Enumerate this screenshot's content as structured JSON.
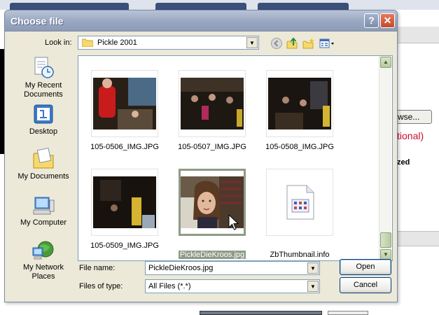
{
  "dialog": {
    "title": "Choose file",
    "help_glyph": "?",
    "close_glyph": "✕"
  },
  "lookin": {
    "label": "Look in:",
    "value": "Pickle 2001"
  },
  "toolbar": {
    "icons": [
      "back-icon",
      "up-folder-icon",
      "new-folder-icon",
      "views-menu-icon"
    ]
  },
  "places": [
    {
      "label": "My Recent Documents",
      "icon": "recent-documents-icon"
    },
    {
      "label": "Desktop",
      "icon": "desktop-icon"
    },
    {
      "label": "My Documents",
      "icon": "my-documents-icon"
    },
    {
      "label": "My Computer",
      "icon": "my-computer-icon"
    },
    {
      "label": "My Network Places",
      "icon": "network-places-icon"
    }
  ],
  "files": [
    {
      "name": "105-0506_IMG.JPG",
      "selected": false
    },
    {
      "name": "105-0507_IMG.JPG",
      "selected": false
    },
    {
      "name": "105-0508_IMG.JPG",
      "selected": false
    },
    {
      "name": "105-0509_IMG.JPG",
      "selected": false
    },
    {
      "name": "PickleDieKroos.jpg",
      "selected": true
    },
    {
      "name": "ZbThumbnail.info",
      "selected": false
    }
  ],
  "filename": {
    "label": "File name:",
    "value": "PickleDieKroos.jpg"
  },
  "filetype": {
    "label": "Files of type:",
    "value": "All Files (*.*)"
  },
  "buttons": {
    "open": "Open",
    "cancel": "Cancel"
  },
  "background_page": {
    "browse_label": "wse...",
    "optional_text": "tional)",
    "sized_text": "zed"
  },
  "colors": {
    "selection": "#8f9b86",
    "titlebar": "#9aa8c2",
    "optional_red": "#c8102e"
  }
}
